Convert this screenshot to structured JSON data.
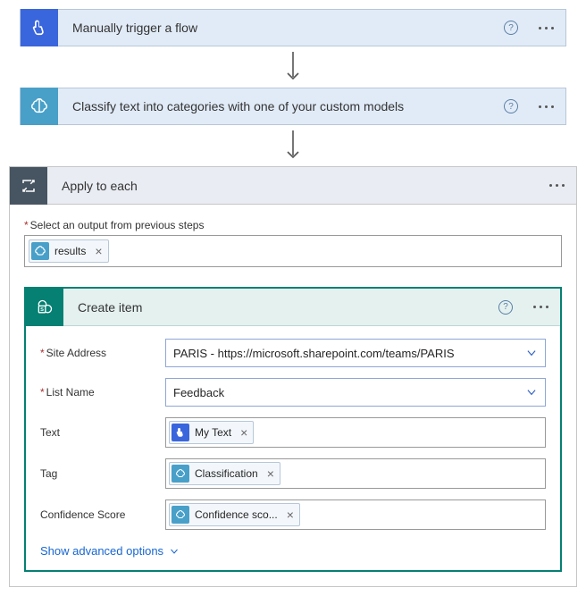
{
  "step1": {
    "title": "Manually trigger a flow"
  },
  "step2": {
    "title": "Classify text into categories with one of your custom models"
  },
  "apply": {
    "title": "Apply to each",
    "selectLabel": "Select an output from previous steps",
    "token": "results"
  },
  "create": {
    "title": "Create item",
    "fields": {
      "siteAddress": {
        "label": "Site Address",
        "value": "PARIS - https://microsoft.sharepoint.com/teams/PARIS"
      },
      "listName": {
        "label": "List Name",
        "value": "Feedback"
      },
      "text": {
        "label": "Text",
        "token": "My Text"
      },
      "tag": {
        "label": "Tag",
        "token": "Classification"
      },
      "confidence": {
        "label": "Confidence Score",
        "token": "Confidence sco..."
      }
    },
    "advanced": "Show advanced options"
  }
}
